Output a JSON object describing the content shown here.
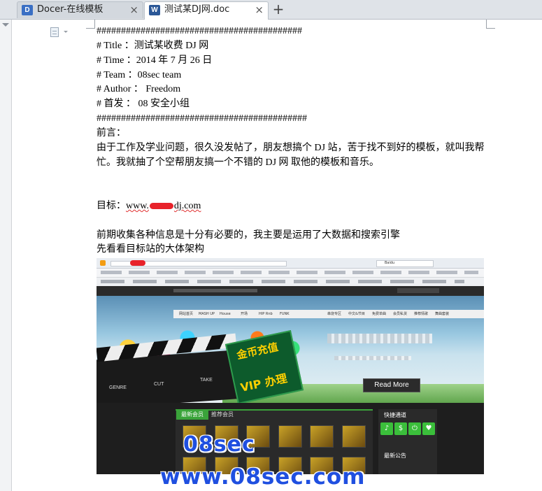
{
  "tabs": [
    {
      "label": "Docer-在线模板",
      "icon": "docer-icon",
      "icon_glyph": "D",
      "icon_color": "#3a6fc4",
      "active": false
    },
    {
      "label": "测试某DJ网.doc",
      "icon": "word-document-icon",
      "icon_glyph": "W",
      "icon_color": "#2b5797",
      "active": true
    }
  ],
  "tab_close_glyph": "×",
  "new_tab_glyph": "+",
  "document": {
    "lines": [
      "##########################################",
      "#  Title     ：测试某收费 DJ 网",
      "#  Time    ：2014 年 7 月 26 日",
      "#  Team  ：08sec team",
      "#  Author  ：   Freedom",
      "#  首发    ：  08 安全小组",
      "###########################################",
      "前言：",
      "由于工作及学业问题，很久没发帖了，朋友想搞个 DJ 站，苦于找不到好的模板，就叫我帮",
      "忙。我就抽了个空帮朋友搞一个不错的 DJ 网   取他的模板和音乐。",
      "",
      "",
      "目标：",
      "",
      "前期收集各种信息是十分有必要的，我主要是运用了大数据和搜索引擎",
      "先看看目标站的大体架构"
    ],
    "target_prefix": "www.",
    "target_suffix": "dj.com"
  },
  "screenshot": {
    "browser_search": "Baidu",
    "nav_items": [
      "网站首页",
      "MASH UP",
      "House",
      "开场",
      "HIP Rnb",
      "FUNK",
      "串烧专区",
      "中文&节目",
      "免费单曲",
      "会员私货",
      "推荐情歌",
      "舞曲套装"
    ],
    "banner_text_1": "金币充值",
    "banner_text_2": "VIP 办理",
    "clapper_labels": [
      "GENRE",
      "CUT",
      "TAKE"
    ],
    "read_more": "Read More",
    "panel_tab_active": "最新会员",
    "panel_tab_other": "推荐会员",
    "right_title": "快捷通道",
    "right_title_2": "最新公告",
    "green_buttons": [
      "♪",
      "$",
      "⏻",
      "♥"
    ],
    "accent_green": "#3aa33a"
  },
  "watermark": {
    "line1": "08sec",
    "line2": "www.08sec.com",
    "color": "#1f4fe0"
  }
}
